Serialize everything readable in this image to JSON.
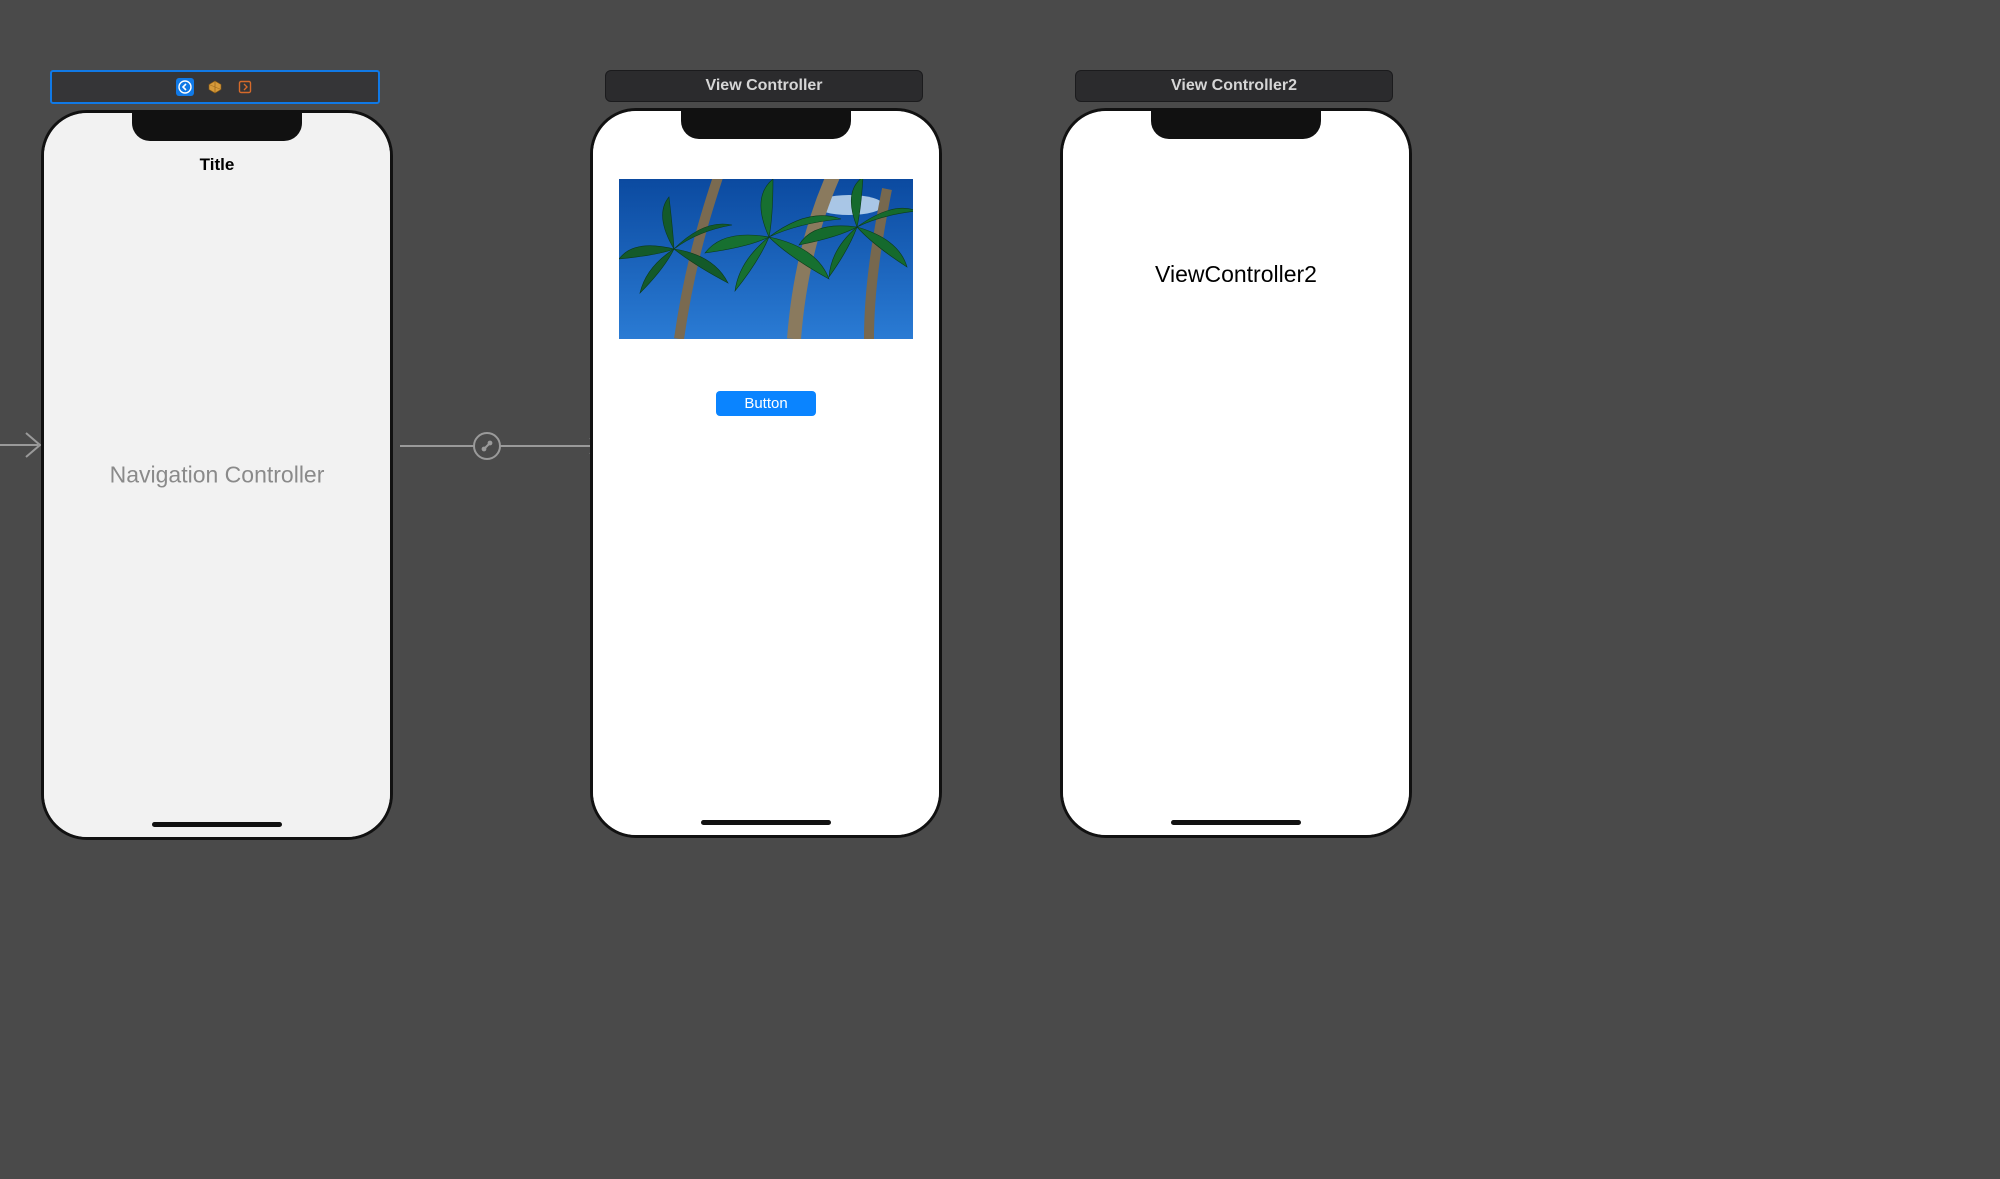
{
  "scenes": {
    "nav": {
      "header_icons": [
        "back-chevron-icon",
        "cube-icon",
        "exit-icon"
      ],
      "nav_title": "Title",
      "placeholder": "Navigation Controller"
    },
    "vc1": {
      "header": "View Controller",
      "button_label": "Button",
      "image_desc": "palm-trees-against-blue-sky"
    },
    "vc2": {
      "header": "View Controller2",
      "body_label": "ViewController2"
    }
  },
  "segues": {
    "root": {
      "type": "relationship",
      "from": "nav",
      "to": "vc1"
    }
  },
  "colors": {
    "selection_blue": "#1079e6",
    "ios_button_blue": "#0a84ff",
    "canvas_bg": "#4a4a4a",
    "placeholder_grey": "#8a8a8a"
  }
}
